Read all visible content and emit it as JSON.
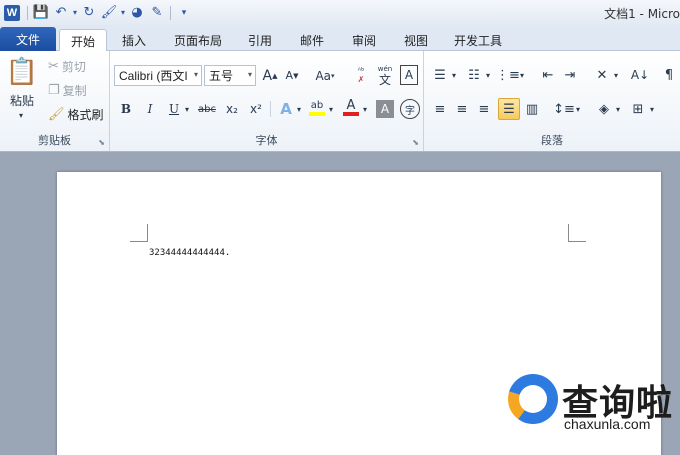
{
  "window": {
    "title": "文档1 - Micro"
  },
  "qat": {
    "app_icon": "W"
  },
  "tabs": [
    {
      "label": "文件"
    },
    {
      "label": "开始"
    },
    {
      "label": "插入"
    },
    {
      "label": "页面布局"
    },
    {
      "label": "引用"
    },
    {
      "label": "邮件"
    },
    {
      "label": "审阅"
    },
    {
      "label": "视图"
    },
    {
      "label": "开发工具"
    }
  ],
  "clipboard": {
    "paste_label": "粘贴",
    "cut_label": "剪切",
    "copy_label": "复制",
    "format_painter_label": "格式刷",
    "group_label": "剪贴板"
  },
  "font": {
    "font_name": "Calibri (西文I",
    "font_size": "五号",
    "grow_glyph": "A",
    "shrink_glyph": "A",
    "case_glyph": "Aa",
    "phonetic_glyph": "wén",
    "phonetic_char": "文",
    "border_char_glyph": "A",
    "bold_glyph": "B",
    "italic_glyph": "I",
    "underline_glyph": "U",
    "strike_glyph": "abc",
    "subscript_glyph": "x₂",
    "superscript_glyph": "x²",
    "text_effect_glyph": "A",
    "highlight_glyph": "ab",
    "font_color_glyph": "A",
    "char_shading_glyph": "A",
    "enclose_glyph": "字",
    "group_label": "字体",
    "font_color": "#e02020",
    "highlight_color": "#ffff00"
  },
  "paragraph": {
    "group_label": "段落"
  },
  "document": {
    "text": "32344444444444."
  },
  "watermark": {
    "brand": "查询啦",
    "url": "chaxunla.com"
  }
}
